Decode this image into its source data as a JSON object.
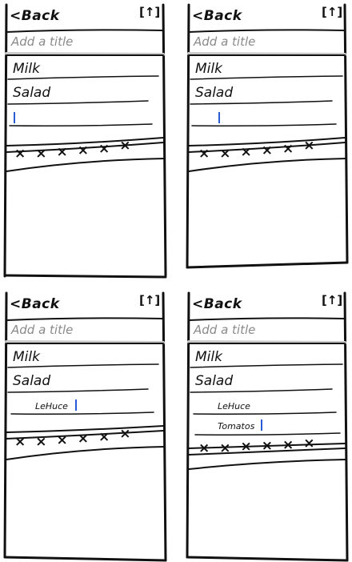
{
  "nav": {
    "back_label": "<Back",
    "share_icon": "share-icon"
  },
  "title_placeholder": "Add a title",
  "items": [
    "Milk",
    "Salad"
  ],
  "subitems": [
    "LeHuce",
    "Tomatos"
  ],
  "toolbar_glyph": "×"
}
